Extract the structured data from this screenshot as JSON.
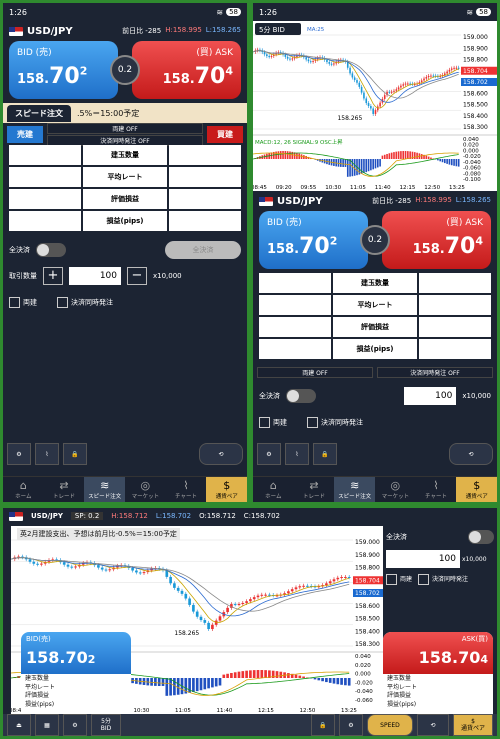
{
  "status": {
    "time": "1:26",
    "battery": "58"
  },
  "pair": "USD/JPY",
  "prev_label": "前日比 -285",
  "high": "H:158.995",
  "low": "L:158.265",
  "bid": {
    "label": "BID (売)",
    "int": "158.",
    "big": "70",
    "sup": "2"
  },
  "ask": {
    "label": "(買) ASK",
    "int": "158.",
    "big": "70",
    "sup": "4"
  },
  "spread": "0.2",
  "speed_tab": "スピード注文",
  "news": ".5%＝15:00予定",
  "buy_tab": "売建",
  "sell_tab": "買建",
  "opt_both": "両建 OFF",
  "opt_settle": "決済同時発注 OFF",
  "grid_labels": [
    "建玉数量",
    "平均レート",
    "評価損益",
    "損益(pips)"
  ],
  "all_close_label": "全決済",
  "all_close_btn": "全決済",
  "qty_label": "取引数量",
  "qty": "100",
  "unit": "x10,000",
  "chk_both": "両建",
  "chk_settle": "決済同時発注",
  "icons": {
    "speed": "SPEED"
  },
  "tabs": [
    "ホーム",
    "トレード",
    "スピード注文",
    "マーケット",
    "チャート",
    "通貨ペア"
  ],
  "chart": {
    "timeframe": "5分 BID",
    "ma": "MA:25",
    "macd": "MACD:12, 26  SIGNAL:9  OSC上昇",
    "low_mark": "158.265",
    "price_ticks": [
      "159.000",
      "158.900",
      "158.800",
      "158.704",
      "158.702",
      "158.600",
      "158.500",
      "158.400",
      "158.300"
    ],
    "macd_ticks": [
      "0.040",
      "0.020",
      "0.000",
      "-0.020",
      "-0.040",
      "-0.060",
      "-0.080",
      "-0.100"
    ],
    "time_ticks": [
      "08:45",
      "09:20",
      "09:55",
      "10:30",
      "11:05",
      "11:40",
      "12:15",
      "12:50",
      "13:25"
    ]
  },
  "land": {
    "sp": "SP: 0.2",
    "h": "H:158.712",
    "l": "L:158.702",
    "o": "O:158.712",
    "c": "C:158.702",
    "news": "英2月建設支出、予想は前月比-0.5%＝15:00予定",
    "bid_label": "BID(売)",
    "ask_label": "ASK(買)",
    "tf": "5分",
    "tf2": "BID",
    "price_ticks": [
      "159.000",
      "158.900",
      "158.800",
      "158.704",
      "158.702",
      "158.600",
      "158.500",
      "158.400",
      "158.300"
    ],
    "macd_ticks": [
      "0.040",
      "0.020",
      "0.000",
      "-0.020",
      "-0.040",
      "-0.060"
    ],
    "time_ticks": [
      "08:45",
      "09:20",
      "09:55",
      "10:30",
      "11:05",
      "11:40",
      "12:15",
      "12:50",
      "13:25"
    ]
  }
}
